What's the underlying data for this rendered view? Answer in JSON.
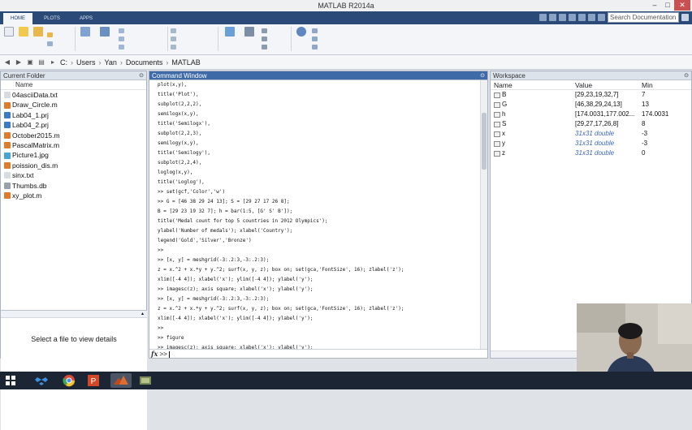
{
  "window": {
    "title": "MATLAB R2014a"
  },
  "toolstrip": {
    "tabs": [
      "HOME",
      "PLOTS",
      "APPS"
    ],
    "search_placeholder": "Search Documentation"
  },
  "address": {
    "path": [
      "C:",
      "Users",
      "Yan",
      "Documents",
      "MATLAB"
    ],
    "separator": "›"
  },
  "current_folder": {
    "title": "Current Folder",
    "column": "Name",
    "files": [
      {
        "name": "04asciiData.txt",
        "icon": "text-file-icon"
      },
      {
        "name": "Draw_Circle.m",
        "icon": "m-file-icon"
      },
      {
        "name": "Lab04_1.prj",
        "icon": "project-file-icon"
      },
      {
        "name": "Lab04_2.prj",
        "icon": "project-file-icon"
      },
      {
        "name": "October2015.m",
        "icon": "m-file-icon"
      },
      {
        "name": "PascalMatrix.m",
        "icon": "m-file-icon"
      },
      {
        "name": "Picture1.jpg",
        "icon": "image-file-icon"
      },
      {
        "name": "poission_dis.m",
        "icon": "m-file-icon"
      },
      {
        "name": "sinx.txt",
        "icon": "text-file-icon"
      },
      {
        "name": "Thumbs.db",
        "icon": "db-file-icon"
      },
      {
        "name": "xy_plot.m",
        "icon": "m-file-icon"
      }
    ],
    "details_message": "Select a file to view details"
  },
  "command_window": {
    "title": "Command Window",
    "lines": [
      "plot(x,y),",
      "title('Plot'),",
      "subplot(2,2,2),",
      "semilogx(x,y),",
      "title('Semilogx'),",
      "subplot(2,2,3),",
      "semilogy(x,y),",
      "title('Semilogy'),",
      "subplot(2,2,4),",
      "loglog(x,y),",
      "title('Loglog'),",
      ">> set(gcf,'Color','w')",
      ">> G = [46 38 29 24 13]; S = [29 27 17 26 8];",
      "B = [29 23 19 32 7]; h = bar(1:5, [G' S' B']);",
      "title('Medal count for top 5 countries in 2012 Olympics');",
      "ylabel('Number of medals'); xlabel('Country');",
      "legend('Gold','Silver','Bronze')",
      ">>",
      ">> [x, y] = meshgrid(-3:.2:3,-3:.2:3);",
      "z = x.^2 + x.*y + y.^2; surf(x, y, z); box on; set(gca,'FontSize', 16); zlabel('z');",
      "xlim([-4 4]); xlabel('x'); ylim([-4 4]); ylabel('y');",
      ">> imagesc(z); axis square; xlabel('x'); ylabel('y');",
      ">> [x, y] = meshgrid(-3:.2:3,-3:.2:3);",
      "z = x.^2 + x.*y + y.^2; surf(x, y, z); box on; set(gca,'FontSize', 16); zlabel('z');",
      "xlim([-4 4]); xlabel('x'); ylim([-4 4]); ylabel('y');",
      ">>",
      ">> figure",
      ">> imagesc(z); axis square; xlabel('x'); ylabel('y');"
    ],
    "prompt_fx": "fx",
    "prompt": ">>"
  },
  "workspace": {
    "title": "Workspace",
    "columns": [
      "Name",
      "Value",
      "Min"
    ],
    "variables": [
      {
        "name": "B",
        "value": "[29,23,19,32,7]",
        "min": "7",
        "italic": false
      },
      {
        "name": "G",
        "value": "[46,38,29,24,13]",
        "min": "13",
        "italic": false
      },
      {
        "name": "h",
        "value": "[174.0031,177.002...",
        "min": "174.0031",
        "italic": false
      },
      {
        "name": "S",
        "value": "[29,27,17,26,8]",
        "min": "8",
        "italic": false
      },
      {
        "name": "x",
        "value": "31x31 double",
        "min": "-3",
        "italic": true
      },
      {
        "name": "y",
        "value": "31x31 double",
        "min": "-3",
        "italic": true
      },
      {
        "name": "z",
        "value": "31x31 double",
        "min": "0",
        "italic": true
      }
    ]
  },
  "taskbar": {
    "apps": [
      "windows-start-icon",
      "file-explorer-icon",
      "dropbox-icon",
      "chrome-icon",
      "powerpoint-icon",
      "matlab-icon",
      "video-app-icon"
    ]
  }
}
